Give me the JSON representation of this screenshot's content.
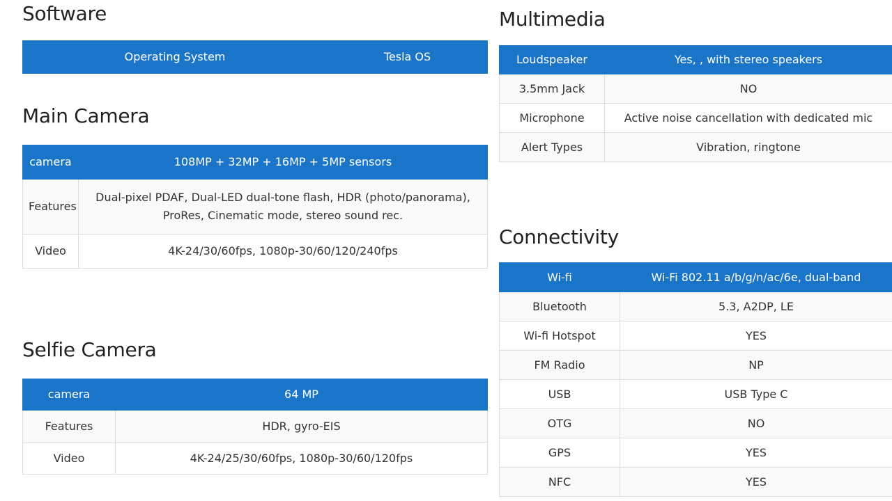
{
  "software": {
    "title": "Software",
    "header": {
      "label": "Operating System",
      "value": "Tesla OS"
    }
  },
  "main_camera": {
    "title": "Main Camera",
    "header": {
      "label": "camera",
      "value": "108MP + 32MP + 16MP + 5MP sensors"
    },
    "rows": [
      {
        "label": "Features",
        "value": "Dual-pixel PDAF, Dual-LED dual-tone flash, HDR (photo/panorama), ProRes, Cinematic mode, stereo sound rec."
      },
      {
        "label": "Video",
        "value": "4K-24/30/60fps, 1080p-30/60/120/240fps"
      }
    ]
  },
  "selfie_camera": {
    "title": "Selfie Camera",
    "header": {
      "label": "camera",
      "value": "64 MP"
    },
    "rows": [
      {
        "label": "Features",
        "value": "HDR, gyro-EIS"
      },
      {
        "label": "Video",
        "value": "4K-24/25/30/60fps, 1080p-30/60/120fps"
      }
    ]
  },
  "multimedia": {
    "title": "Multimedia",
    "header": {
      "label": "Loudspeaker",
      "value": "Yes, , with stereo speakers"
    },
    "rows": [
      {
        "label": "3.5mm Jack",
        "value": "NO"
      },
      {
        "label": "Microphone",
        "value": "Active noise cancellation with dedicated mic"
      },
      {
        "label": "Alert Types",
        "value": "Vibration, ringtone"
      }
    ]
  },
  "connectivity": {
    "title": "Connectivity",
    "header": {
      "label": "Wi-fi",
      "value": "Wi-Fi 802.11 a/b/g/n/ac/6e, dual-band"
    },
    "rows": [
      {
        "label": "Bluetooth",
        "value": "5.3, A2DP, LE"
      },
      {
        "label": "Wi-fi Hotspot",
        "value": "YES"
      },
      {
        "label": "FM Radio",
        "value": "NP"
      },
      {
        "label": "USB",
        "value": "USB Type C"
      },
      {
        "label": "OTG",
        "value": "NO"
      },
      {
        "label": "GPS",
        "value": "YES"
      },
      {
        "label": "NFC",
        "value": "YES"
      }
    ]
  },
  "colors": {
    "header_blue": "#1a75c9",
    "row_alt": "#f9f9f9",
    "border": "#dddddd"
  }
}
